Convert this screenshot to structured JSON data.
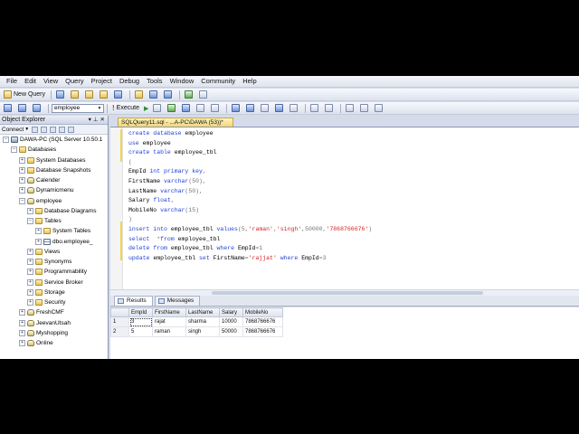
{
  "menu": [
    "File",
    "Edit",
    "View",
    "Query",
    "Project",
    "Debug",
    "Tools",
    "Window",
    "Community",
    "Help"
  ],
  "toolbar1": {
    "new_query": "New Query"
  },
  "toolbar2": {
    "database": "employee",
    "execute": "Execute"
  },
  "object_explorer": {
    "title": "Object Explorer",
    "connect": "Connect",
    "tree": [
      {
        "label": "DAWA-PC (SQL Server 10.50.1",
        "level": 0,
        "expander": "−",
        "icon": "server"
      },
      {
        "label": "Databases",
        "level": 1,
        "expander": "−",
        "icon": "folder"
      },
      {
        "label": "System Databases",
        "level": 2,
        "expander": "+",
        "icon": "folder"
      },
      {
        "label": "Database Snapshots",
        "level": 2,
        "expander": "+",
        "icon": "folder"
      },
      {
        "label": "Calender",
        "level": 2,
        "expander": "+",
        "icon": "db"
      },
      {
        "label": "Dynamicmenu",
        "level": 2,
        "expander": "+",
        "icon": "db"
      },
      {
        "label": "employee",
        "level": 2,
        "expander": "−",
        "icon": "db"
      },
      {
        "label": "Database Diagrams",
        "level": 3,
        "expander": "+",
        "icon": "folder"
      },
      {
        "label": "Tables",
        "level": 3,
        "expander": "−",
        "icon": "folder"
      },
      {
        "label": "System Tables",
        "level": 4,
        "expander": "+",
        "icon": "folder"
      },
      {
        "label": "dbo.employee_",
        "level": 4,
        "expander": "+",
        "icon": "table"
      },
      {
        "label": "Views",
        "level": 3,
        "expander": "+",
        "icon": "folder"
      },
      {
        "label": "Synonyms",
        "level": 3,
        "expander": "+",
        "icon": "folder"
      },
      {
        "label": "Programmability",
        "level": 3,
        "expander": "+",
        "icon": "folder"
      },
      {
        "label": "Service Broker",
        "level": 3,
        "expander": "+",
        "icon": "folder"
      },
      {
        "label": "Storage",
        "level": 3,
        "expander": "+",
        "icon": "folder"
      },
      {
        "label": "Security",
        "level": 3,
        "expander": "+",
        "icon": "folder"
      },
      {
        "label": "FreshCMF",
        "level": 2,
        "expander": "+",
        "icon": "db"
      },
      {
        "label": "JeevanUtsah",
        "level": 2,
        "expander": "+",
        "icon": "db"
      },
      {
        "label": "Myshopping",
        "level": 2,
        "expander": "+",
        "icon": "db"
      },
      {
        "label": "Online",
        "level": 2,
        "expander": "+",
        "icon": "db"
      }
    ]
  },
  "editor": {
    "tab_title": "SQLQuery11.sql - ...A-PC\\DAWA (53))*",
    "lines": [
      [
        {
          "t": "create database ",
          "c": "kw"
        },
        {
          "t": "employee",
          "c": ""
        }
      ],
      [
        {
          "t": "use ",
          "c": "kw"
        },
        {
          "t": "employee",
          "c": ""
        }
      ],
      [
        {
          "t": "create table ",
          "c": "kw"
        },
        {
          "t": "employee_tbl",
          "c": ""
        }
      ],
      [
        {
          "t": "(",
          "c": "op"
        }
      ],
      [
        {
          "t": "EmpId ",
          "c": ""
        },
        {
          "t": "int primary key",
          "c": "kw"
        },
        {
          "t": ",",
          "c": "op"
        }
      ],
      [
        {
          "t": "FirstName ",
          "c": ""
        },
        {
          "t": "varchar",
          "c": "kw"
        },
        {
          "t": "(50),",
          "c": "op"
        }
      ],
      [
        {
          "t": "LastName ",
          "c": ""
        },
        {
          "t": "varchar",
          "c": "kw"
        },
        {
          "t": "(50),",
          "c": "op"
        }
      ],
      [
        {
          "t": "Salary ",
          "c": ""
        },
        {
          "t": "float",
          "c": "kw"
        },
        {
          "t": ",",
          "c": "op"
        }
      ],
      [
        {
          "t": "MobileNo ",
          "c": ""
        },
        {
          "t": "varchar",
          "c": "kw"
        },
        {
          "t": "(15)",
          "c": "op"
        }
      ],
      [
        {
          "t": ")",
          "c": "op"
        }
      ],
      [
        {
          "t": "insert into ",
          "c": "kw"
        },
        {
          "t": "employee_tbl ",
          "c": ""
        },
        {
          "t": "values",
          "c": "kw"
        },
        {
          "t": "(5,",
          "c": "op"
        },
        {
          "t": "'raman'",
          "c": "str"
        },
        {
          "t": ",",
          "c": "op"
        },
        {
          "t": "'singh'",
          "c": "str"
        },
        {
          "t": ",50000,",
          "c": "op"
        },
        {
          "t": "'7868766676'",
          "c": "str"
        },
        {
          "t": ")",
          "c": "op"
        }
      ],
      [
        {
          "t": "select  ",
          "c": "kw"
        },
        {
          "t": "*",
          "c": "op"
        },
        {
          "t": "from ",
          "c": "kw"
        },
        {
          "t": "employee_tbl",
          "c": ""
        }
      ],
      [
        {
          "t": "delete from ",
          "c": "kw"
        },
        {
          "t": "employee_tbl ",
          "c": ""
        },
        {
          "t": "where ",
          "c": "kw"
        },
        {
          "t": "EmpId",
          "c": ""
        },
        {
          "t": "=1",
          "c": "op"
        }
      ],
      [
        {
          "t": "update ",
          "c": "kw"
        },
        {
          "t": "employee_tbl ",
          "c": ""
        },
        {
          "t": "set ",
          "c": "kw"
        },
        {
          "t": "FirstName",
          "c": ""
        },
        {
          "t": "=",
          "c": "op"
        },
        {
          "t": "'rajjat'",
          "c": "str"
        },
        {
          "t": " where ",
          "c": "kw"
        },
        {
          "t": "EmpId",
          "c": ""
        },
        {
          "t": "=3",
          "c": "op"
        }
      ]
    ]
  },
  "results": {
    "tabs": [
      "Results",
      "Messages"
    ],
    "columns": [
      "EmpId",
      "FirstName",
      "LastName",
      "Salary",
      "MobileNo"
    ],
    "rows": [
      {
        "rownum": "1",
        "cells": [
          "3",
          "rajat",
          "sharma",
          "10000",
          "7868766676"
        ]
      },
      {
        "rownum": "2",
        "cells": [
          "5",
          "raman",
          "singh",
          "50000",
          "7868766676"
        ]
      }
    ]
  },
  "colors": {
    "keyword": "#1f3fd6",
    "string": "#d0262a",
    "operator": "#777777",
    "chrome": "#d6dbe9"
  }
}
